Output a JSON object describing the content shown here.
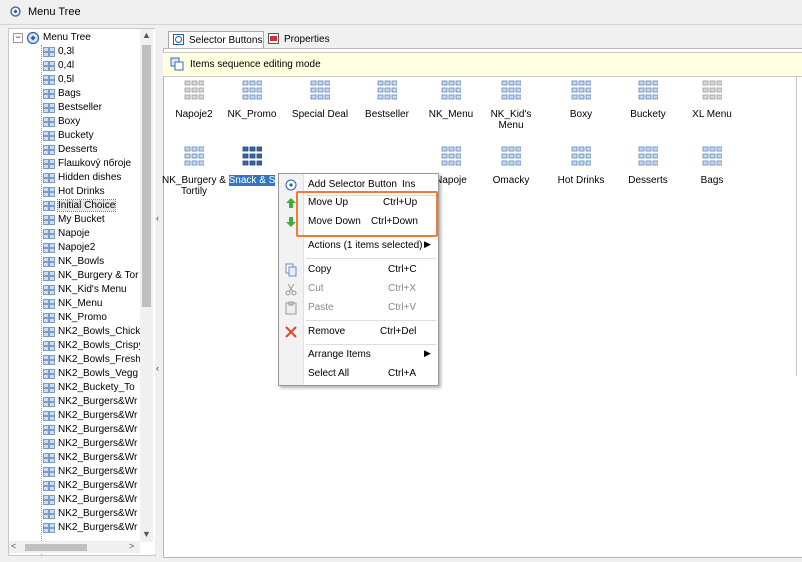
{
  "window": {
    "title": "Menu Tree"
  },
  "tree": {
    "root": "Menu Tree",
    "items": [
      "0,3l",
      "0,4l",
      "0,5l",
      "Bags",
      "Bestseller",
      "Boxy",
      "Buckety",
      "Desserts",
      "Flaшkový пбroje",
      "Hidden dishes",
      "Hot Drinks",
      "Initial Choice",
      "My Bucket",
      "Napoje",
      "Napoje2",
      "NK_Bowls",
      "NK_Burgery & Tor",
      "NK_Kid's Menu",
      "NK_Menu",
      "NK_Promo",
      "NK2_Bowls_Chick",
      "NK2_Bowls_Crispy",
      "NK2_Bowls_Fresh",
      "NK2_Bowls_Vegg",
      "NK2_Buckety_To",
      "NK2_Burgers&Wr",
      "NK2_Burgers&Wr",
      "NK2_Burgers&Wr",
      "NK2_Burgers&Wr",
      "NK2_Burgers&Wr",
      "NK2_Burgers&Wr",
      "NK2_Burgers&Wr",
      "NK2_Burgers&Wr",
      "NK2_Burgers&Wr",
      "NK2_Burgers&Wr"
    ],
    "selected_index": 11
  },
  "tabs": [
    {
      "label": "Selector Buttons",
      "active": true
    },
    {
      "label": "Properties",
      "active": false
    }
  ],
  "mode_banner": "Items sequence editing mode",
  "buttons_row1": [
    "Napoje2",
    "NK_Promo",
    "Special Deal",
    "Bestseller",
    "NK_Menu",
    "NK_Kid's Menu",
    "Boxy",
    "Buckety",
    "XL Menu"
  ],
  "buttons_row2": [
    "NK_Burgery & Tortily",
    "Snack & S",
    "",
    "",
    "Napoje",
    "Omacky",
    "Hot Drinks",
    "Desserts",
    "Bags"
  ],
  "context_menu": {
    "add": {
      "label": "Add Selector Button",
      "shortcut": "Ins"
    },
    "move_up": {
      "label": "Move Up",
      "shortcut": "Ctrl+Up"
    },
    "move_down": {
      "label": "Move Down",
      "shortcut": "Ctrl+Down"
    },
    "actions": {
      "label": "Actions (1 items selected)"
    },
    "copy": {
      "label": "Copy",
      "shortcut": "Ctrl+C"
    },
    "cut": {
      "label": "Cut",
      "shortcut": "Ctrl+X"
    },
    "paste": {
      "label": "Paste",
      "shortcut": "Ctrl+V"
    },
    "remove": {
      "label": "Remove",
      "shortcut": "Ctrl+Del"
    },
    "arrange": {
      "label": "Arrange Items"
    },
    "select_all": {
      "label": "Select All",
      "shortcut": "Ctrl+A"
    }
  },
  "colors": {
    "highlight_box": "#f07b33",
    "selection": "#3374c4",
    "banner": "#ffffe1"
  }
}
